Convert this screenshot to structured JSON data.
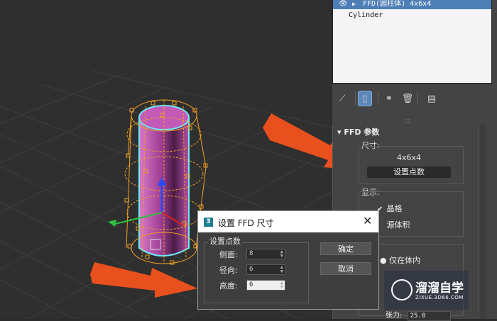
{
  "stack": {
    "modifier_label": "FFD(圆柱体) 4x6x4",
    "base_object_label": "Cylinder"
  },
  "rollout": {
    "title": "FFD 参数",
    "dimensions": {
      "group_label": "尺寸:",
      "value": "4x6x4",
      "set_points_button": "设置点数"
    },
    "display": {
      "group_label": "显示:",
      "lattice_label": "晶格",
      "lattice_checked": true,
      "source_volume_label": "源体积",
      "source_volume_checked": false
    },
    "deform": {
      "only_in_volume_label": "仅在体内"
    },
    "tension": {
      "label": "张力:",
      "value": "25.0"
    }
  },
  "dialog": {
    "app_icon": "3",
    "title": "设置 FFD 尺寸",
    "close_symbol": "✕",
    "group_label": "设置点数",
    "fields": [
      {
        "label": "侧面:",
        "value": "8"
      },
      {
        "label": "径向:",
        "value": "6"
      },
      {
        "label": "高度:",
        "value": "6"
      }
    ],
    "ok_button": "确定",
    "cancel_button": "取消"
  },
  "watermark": {
    "title": "溜溜自学",
    "url": "ZIXUE.3D66.COM"
  },
  "icons": {
    "eye": "eye-icon",
    "pin": "pin-icon",
    "modifier-stack": "modifier-stack-icon",
    "make-unique": "make-unique-icon",
    "delete": "trash-icon",
    "configure": "configure-icon"
  },
  "colors": {
    "arrow": "#e8501e",
    "lattice": "#f0a020",
    "cylinder": "#b24fa8",
    "selection": "#4d7fb6"
  }
}
